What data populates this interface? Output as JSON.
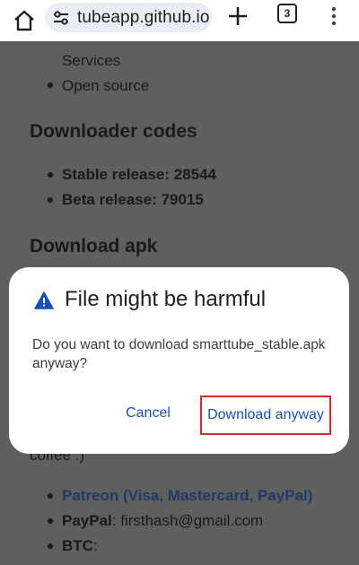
{
  "toolbar": {
    "url": "tubeapp.github.io",
    "tab_count": "3"
  },
  "page": {
    "cut_line": "Services",
    "list1": [
      "Open source"
    ],
    "heading_codes": "Downloader codes",
    "codes": [
      {
        "label": "Stable release: 28544"
      },
      {
        "label": "Beta release: 79015"
      }
    ],
    "heading_apk": "Download apk",
    "coffee_text": "coffee :)",
    "donations": {
      "patreon": "Patreon (Visa, Mastercard, PayPal)",
      "paypal_label": "PayPal",
      "paypal_value": ": firsthash@gmail.com",
      "btc_label": "BTC",
      "btc_value": ":"
    }
  },
  "dialog": {
    "icon": "warning-icon",
    "title": "File might be harmful",
    "message": "Do you want to download smarttube_stable.apk anyway?",
    "cancel_label": "Cancel",
    "download_label": "Download anyway",
    "highlight_color": "#d32f2f",
    "accent_color": "#1a4fb4"
  }
}
